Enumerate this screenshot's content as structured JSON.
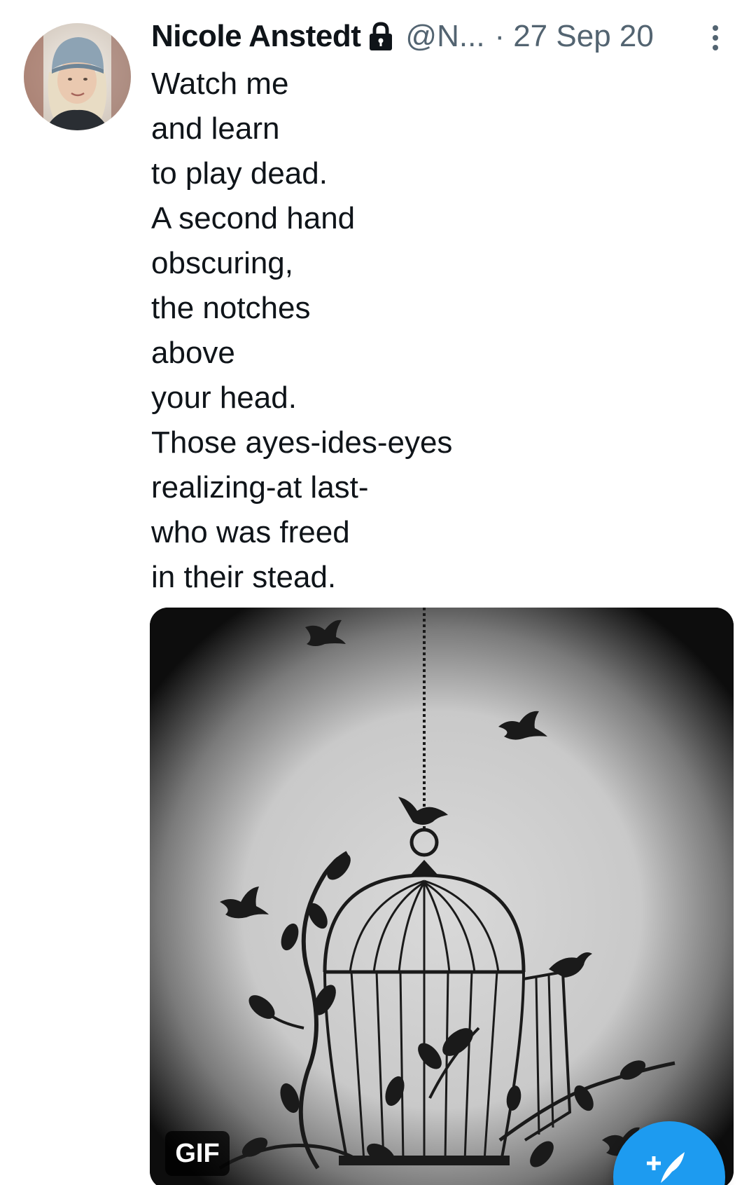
{
  "tweet": {
    "author": {
      "display_name": "Nicole Anstedt",
      "handle": "@N...",
      "protected": true
    },
    "separator": "·",
    "date": "27 Sep 20",
    "lines": [
      "Watch me",
      "and learn",
      "to play dead.",
      "A second hand",
      "obscuring,",
      "the notches",
      "above",
      "your head.",
      "Those ayes-ides-eyes",
      "realizing-at last-",
      "who was freed",
      "in their stead."
    ],
    "media": {
      "badge": "GIF",
      "content": "birdcage-with-birds"
    }
  },
  "icons": {
    "lock": "lock-icon",
    "more": "more-vertical-icon",
    "compose": "compose-plus-feather-icon"
  },
  "colors": {
    "text": "#0f1419",
    "secondary": "#536471",
    "accent": "#1d9bf0"
  }
}
